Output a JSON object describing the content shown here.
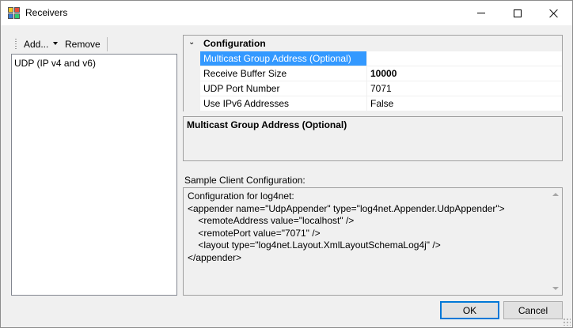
{
  "window": {
    "title": "Receivers",
    "icon": "receivers-app-icon",
    "controls": {
      "minimize": "minimize-icon",
      "maximize": "maximize-icon",
      "close": "close-icon"
    }
  },
  "toolbar": {
    "add_label": "Add...",
    "remove_label": "Remove"
  },
  "receivers_list": {
    "items": [
      "UDP (IP v4 and v6)"
    ]
  },
  "property_grid": {
    "category": "Configuration",
    "rows": [
      {
        "name": "Multicast Group Address (Optional)",
        "value": "",
        "selected": true,
        "bold": false
      },
      {
        "name": "Receive Buffer Size",
        "value": "10000",
        "selected": false,
        "bold": true
      },
      {
        "name": "UDP Port Number",
        "value": "7071",
        "selected": false,
        "bold": false
      },
      {
        "name": "Use IPv6 Addresses",
        "value": "False",
        "selected": false,
        "bold": false
      }
    ]
  },
  "help": {
    "title": "Multicast Group Address (Optional)"
  },
  "sample": {
    "label": "Sample Client Configuration:",
    "lines": [
      "Configuration for log4net:",
      "<appender name=\"UdpAppender\" type=\"log4net.Appender.UdpAppender\">",
      "    <remoteAddress value=\"localhost\" />",
      "    <remotePort value=\"7071\" />",
      "    <layout type=\"log4net.Layout.XmlLayoutSchemaLog4j\" />",
      "</appender>"
    ]
  },
  "buttons": {
    "ok": "OK",
    "cancel": "Cancel"
  },
  "colors": {
    "selection": "#3399ff",
    "accent_border": "#0078d7",
    "dialog_bg": "#f0f0f0"
  }
}
